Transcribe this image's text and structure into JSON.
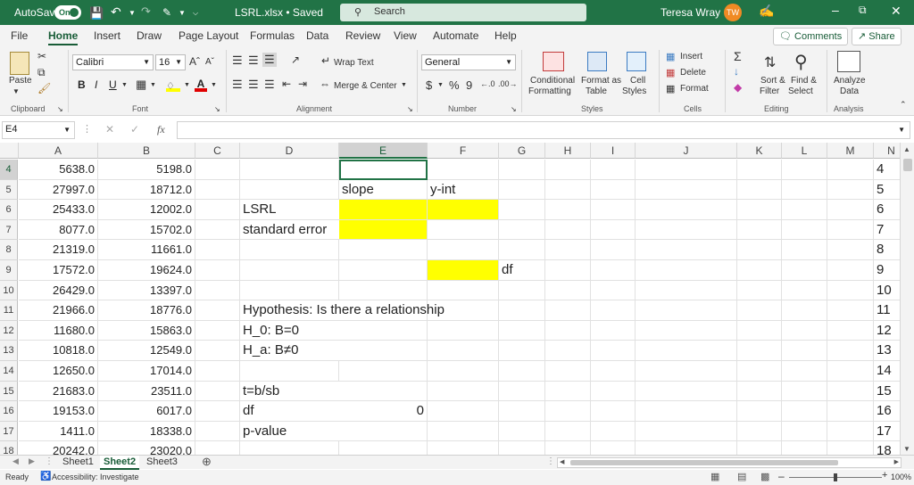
{
  "titlebar": {
    "autosave_label": "AutoSave",
    "autosave_state": "On",
    "filename": "LSRL.xlsx • Saved",
    "search_placeholder": "Search",
    "user_name": "Teresa Wray",
    "user_initials": "TW"
  },
  "menu": {
    "tabs": [
      "File",
      "Home",
      "Insert",
      "Draw",
      "Page Layout",
      "Formulas",
      "Data",
      "Review",
      "View",
      "Automate",
      "Help"
    ],
    "comments_label": "Comments",
    "share_label": "Share"
  },
  "ribbon": {
    "clipboard": {
      "paste": "Paste",
      "group": "Clipboard"
    },
    "font": {
      "name": "Calibri",
      "size": "16",
      "group": "Font"
    },
    "alignment": {
      "wrap": "Wrap Text",
      "merge": "Merge & Center",
      "group": "Alignment"
    },
    "number": {
      "format": "General",
      "group": "Number"
    },
    "styles": {
      "conditional": [
        "Conditional",
        "Formatting"
      ],
      "format_table": [
        "Format as",
        "Table"
      ],
      "cell_styles": [
        "Cell",
        "Styles"
      ],
      "group": "Styles"
    },
    "cells": {
      "insert": "Insert",
      "delete": "Delete",
      "format": "Format",
      "group": "Cells"
    },
    "editing": {
      "sort": [
        "Sort &",
        "Filter"
      ],
      "find": [
        "Find &",
        "Select"
      ],
      "group": "Editing"
    },
    "analysis": {
      "analyze": [
        "Analyze",
        "Data"
      ],
      "group": "Analysis"
    }
  },
  "formula_bar": {
    "name_box": "E4",
    "fx": "fx",
    "value": ""
  },
  "sheet": {
    "columns": [
      "A",
      "B",
      "C",
      "D",
      "E",
      "F",
      "G",
      "H",
      "I",
      "J",
      "K",
      "L",
      "M",
      "N"
    ],
    "rows": [
      {
        "n": "4",
        "a": "5638.0",
        "b": "5198.0"
      },
      {
        "n": "5",
        "a": "27997.0",
        "b": "18712.0",
        "e": "slope",
        "f": "y-int"
      },
      {
        "n": "6",
        "a": "25433.0",
        "b": "12002.0",
        "d": "LSRL"
      },
      {
        "n": "7",
        "a": "8077.0",
        "b": "15702.0",
        "d": "standard error"
      },
      {
        "n": "8",
        "a": "21319.0",
        "b": "11661.0"
      },
      {
        "n": "9",
        "a": "17572.0",
        "b": "19624.0",
        "g": "df"
      },
      {
        "n": "10",
        "a": "26429.0",
        "b": "13397.0"
      },
      {
        "n": "11",
        "a": "21966.0",
        "b": "18776.0",
        "d": "Hypothesis: Is there a relationship"
      },
      {
        "n": "12",
        "a": "11680.0",
        "b": "15863.0",
        "d": "H_0: B=0"
      },
      {
        "n": "13",
        "a": "10818.0",
        "b": "12549.0",
        "d": "H_a: B≠0"
      },
      {
        "n": "14",
        "a": "12650.0",
        "b": "17014.0"
      },
      {
        "n": "15",
        "a": "21683.0",
        "b": "23511.0",
        "d": "t=b/sb"
      },
      {
        "n": "16",
        "a": "19153.0",
        "b": "6017.0",
        "d": "df",
        "e": "0"
      },
      {
        "n": "17",
        "a": "1411.0",
        "b": "18338.0",
        "d": "p-value"
      },
      {
        "n": "18",
        "a": "20242.0",
        "b": "23020.0"
      }
    ],
    "highlight_color": "#ffff00"
  },
  "sheet_tabs": [
    "Sheet1",
    "Sheet2",
    "Sheet3"
  ],
  "status": {
    "ready": "Ready",
    "accessibility": "Accessibility: Investigate",
    "zoom": "100%"
  }
}
